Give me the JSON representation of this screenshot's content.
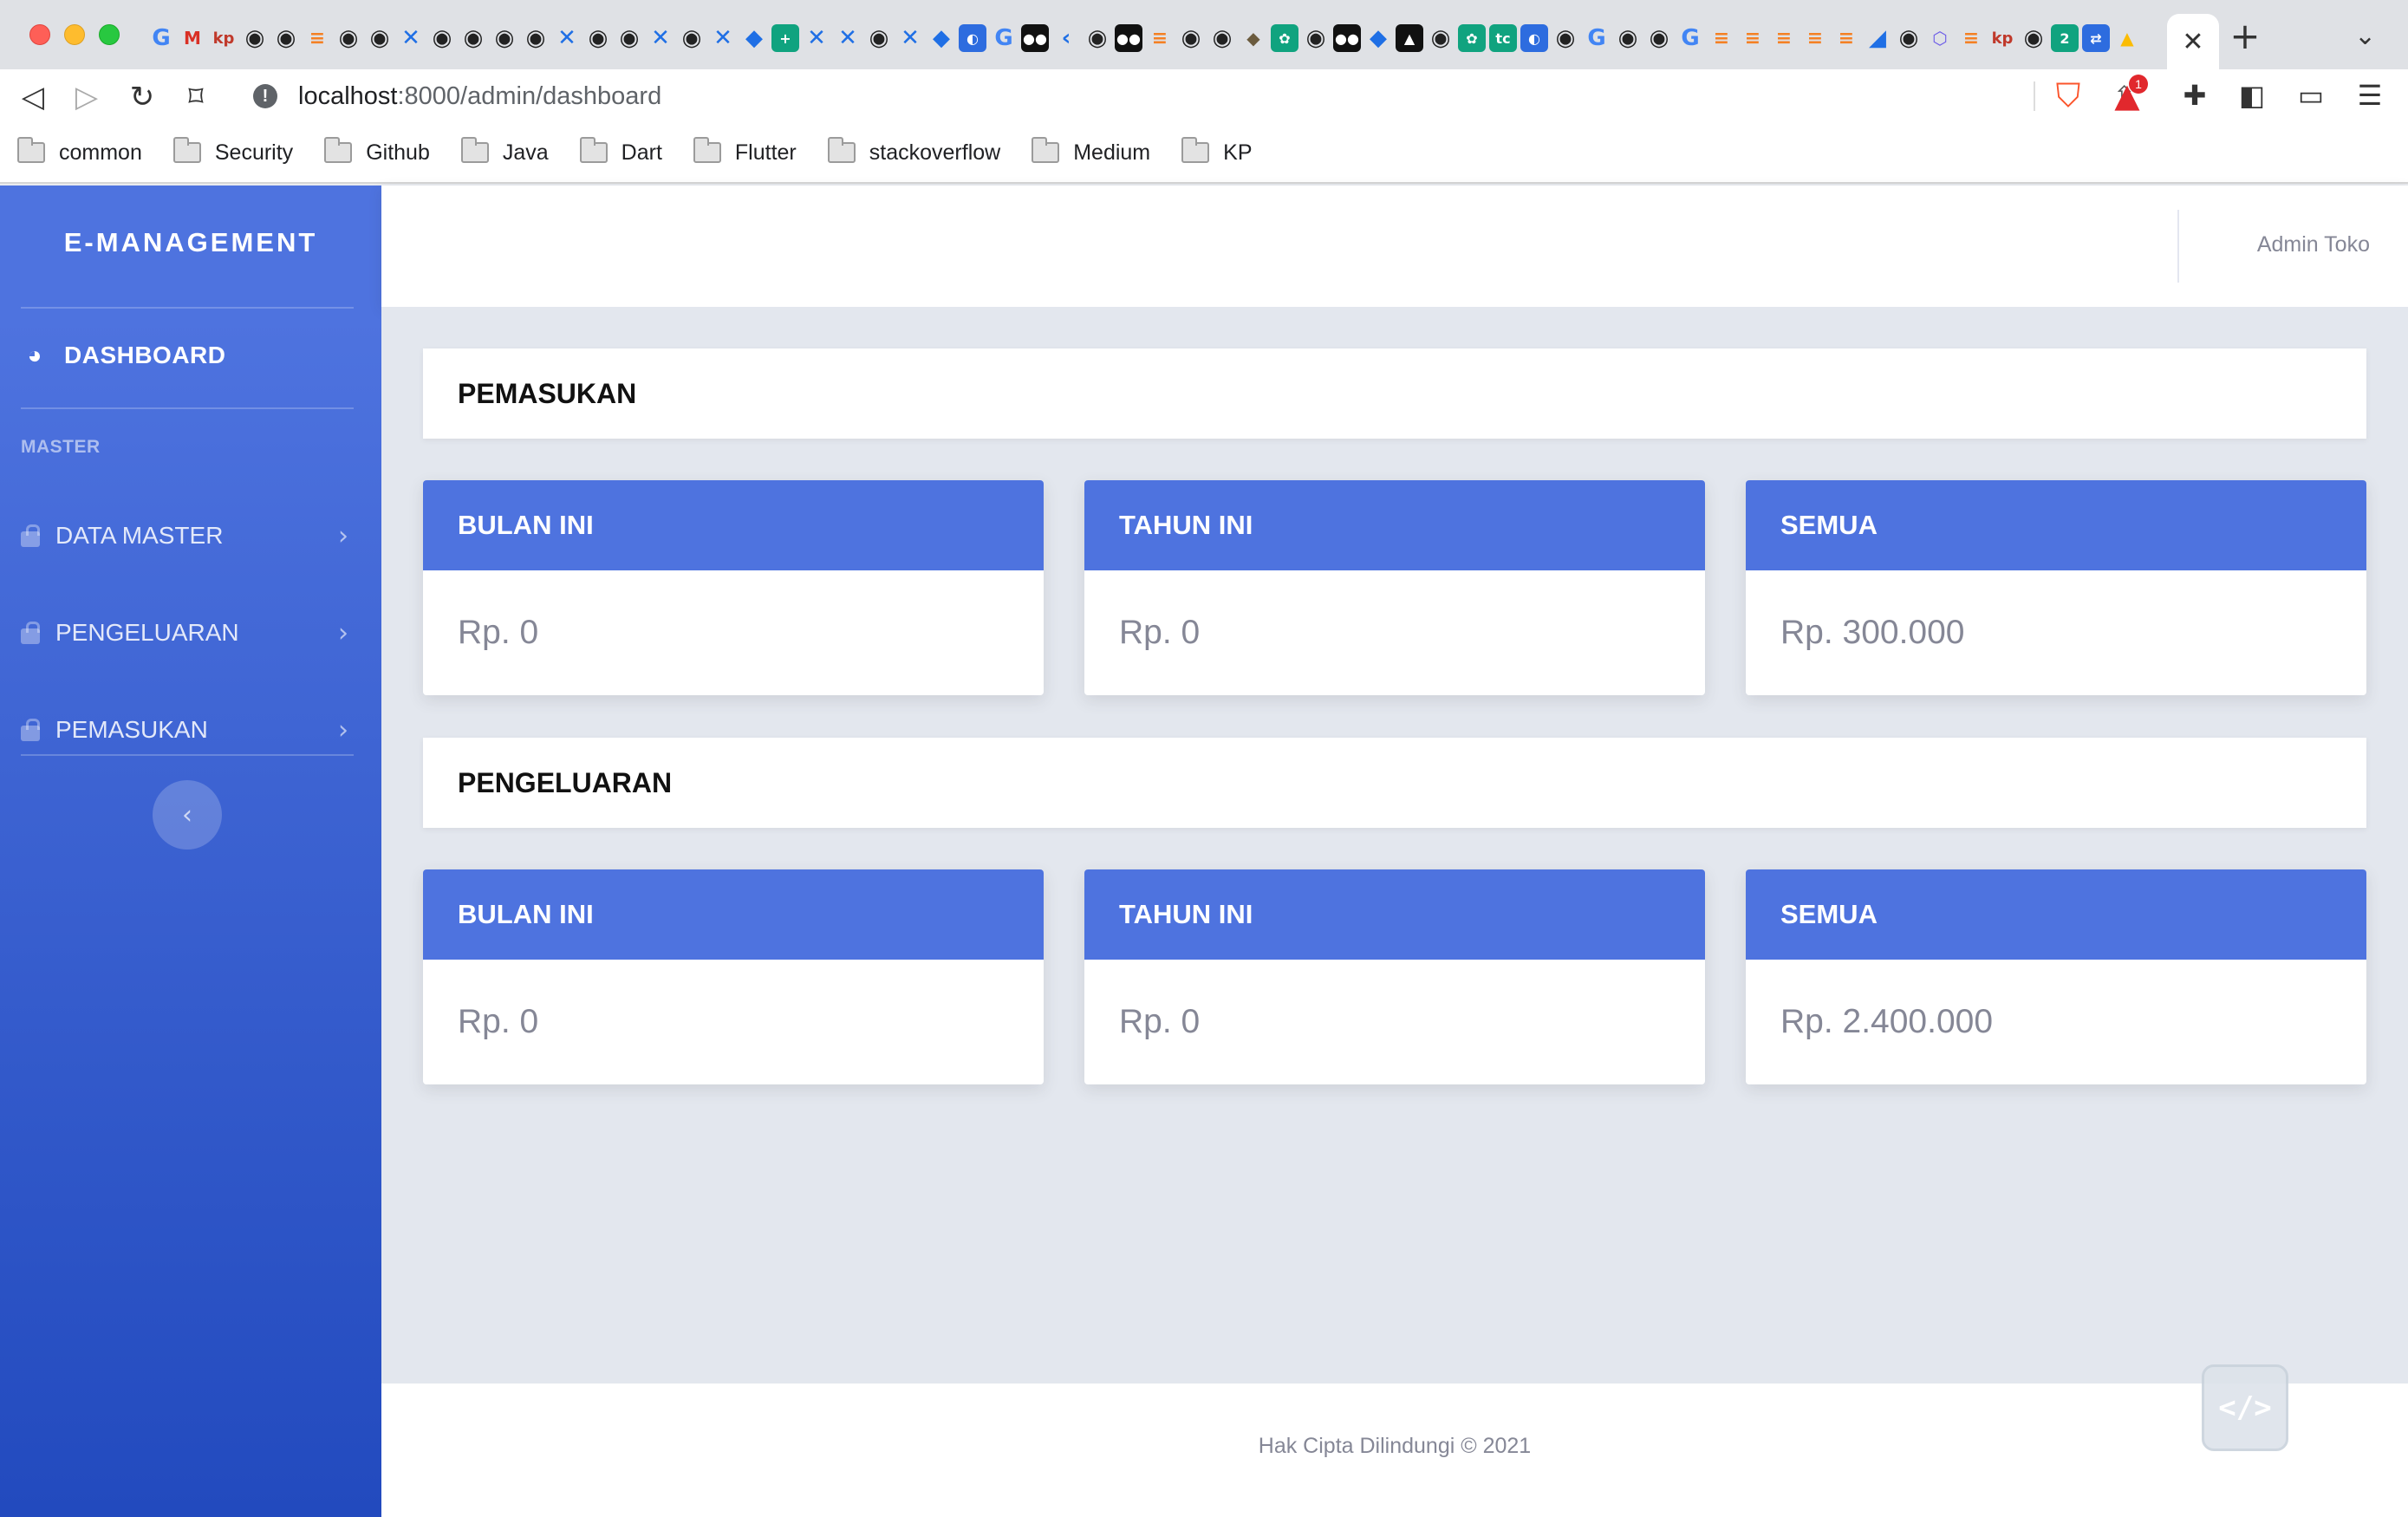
{
  "browser": {
    "url_host": "localhost",
    "url_path": ":8000/admin/dashboard",
    "tab_close_glyph": "✕",
    "new_tab_glyph": "+",
    "extension_badge": "1",
    "bookmarks": [
      "common",
      "Security",
      "Github",
      "Java",
      "Dart",
      "Flutter",
      "stackoverflow",
      "Medium",
      "KP"
    ],
    "tab_favicon_icons": [
      "google-translate-icon",
      "gmail-icon",
      "kp-icon",
      "github-icon",
      "jira-icon",
      "stackoverflow-icon",
      "google-icon",
      "medium-icon",
      "chatgpt-icon",
      "flutter-icon"
    ]
  },
  "sidebar": {
    "brand": "E-MANAGEMENT",
    "dashboard_label": "DASHBOARD",
    "heading": "MASTER",
    "items": [
      {
        "label": "DATA MASTER"
      },
      {
        "label": "PENGELUARAN"
      },
      {
        "label": "PEMASUKAN"
      }
    ]
  },
  "topbar": {
    "user_name": "Admin Toko"
  },
  "sections": {
    "income": {
      "title": "PEMASUKAN",
      "cards": [
        {
          "title": "BULAN INI",
          "value": "Rp. 0"
        },
        {
          "title": "TAHUN INI",
          "value": "Rp. 0"
        },
        {
          "title": "SEMUA",
          "value": "Rp. 300.000"
        }
      ]
    },
    "expense": {
      "title": "PENGELUARAN",
      "cards": [
        {
          "title": "BULAN INI",
          "value": "Rp. 0"
        },
        {
          "title": "TAHUN INI",
          "value": "Rp. 0"
        },
        {
          "title": "SEMUA",
          "value": "Rp. 2.400.000"
        }
      ]
    }
  },
  "footer": {
    "text": "Hak Cipta Dilindungi © 2021"
  },
  "colors": {
    "primary": "#4e73df",
    "sidebar_gradient_end": "#224abe",
    "muted_text": "#858796",
    "content_bg": "#e3e7ee"
  }
}
